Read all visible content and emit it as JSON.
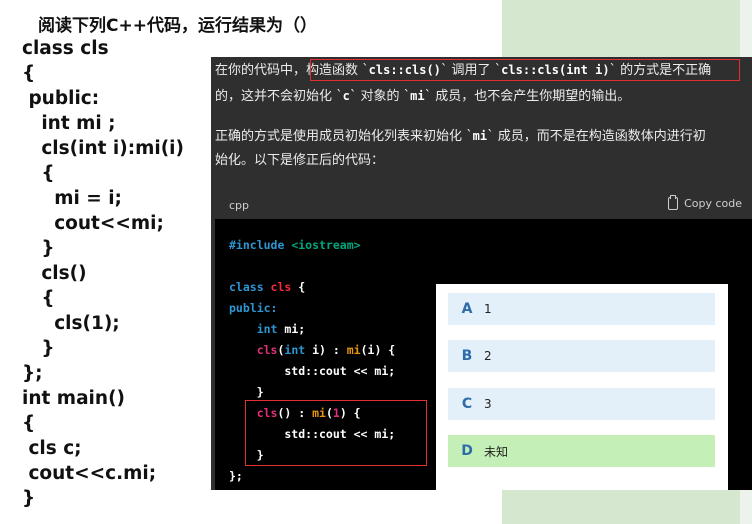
{
  "question": {
    "title": "阅读下列C++代码，运行结果为（）",
    "code_lines": [
      "class cls",
      "{",
      " public:",
      "   int mi ;",
      "   cls(int i):mi(i)",
      "   {",
      "     mi = i;",
      "     cout<<mi;",
      "   }",
      "   cls()",
      "   {",
      "     cls(1);",
      "   }",
      "};",
      "int main()",
      "{",
      " cls c;",
      " cout<<c.mi;",
      "}"
    ]
  },
  "chat": {
    "p1": {
      "a": "在你的代码中，",
      "b": "构造函数 `",
      "c": "cls::cls()",
      "d": "` 调用了 `",
      "e": "cls::cls(int i)",
      "f": "` 的方式是不正确",
      "g": "的，这并不会初始化 `",
      "h": "c",
      "i": "` 对象的 `",
      "j": "mi",
      "k": "` 成员，也不会产生你期望的输出。"
    },
    "p2": {
      "a": "正确的方式是使用成员初始化列表来初始化 `",
      "b": "mi",
      "c": "` 成员，而不是在构造函数体内进行初",
      "d": "始化。以下是修正后的代码："
    },
    "code_block": {
      "language": "cpp",
      "copy_label": "Copy code",
      "copy_icon": "clipboard-icon",
      "code": {
        "l1a": "#include ",
        "l1b": "<iostream>",
        "l3a": "class ",
        "l3b": "cls",
        "l3c": " {",
        "l4": "public:",
        "l5a": "    int",
        "l5b": " mi;",
        "l6a": "    cls",
        "l6b": "(",
        "l6c": "int",
        "l6d": " i) : ",
        "l6e": "mi",
        "l6f": "(i) {",
        "l7": "        std::cout << mi;",
        "l8": "    }",
        "l9a": "    cls",
        "l9b": "() : ",
        "l9c": "mi",
        "l9d": "(",
        "l9e": "1",
        "l9f": ") {",
        "l10": "        std::cout << mi;",
        "l11": "    }",
        "l12": "};"
      }
    }
  },
  "options": [
    {
      "letter": "A",
      "text": "1"
    },
    {
      "letter": "B",
      "text": "2"
    },
    {
      "letter": "C",
      "text": "3"
    },
    {
      "letter": "D",
      "text": "未知"
    }
  ],
  "colors": {
    "highlight_border": "#e03030",
    "option_bg": "#e3f0fa",
    "option_selected_bg": "#c4f0b8",
    "right_panel": "#d5e8cf"
  }
}
